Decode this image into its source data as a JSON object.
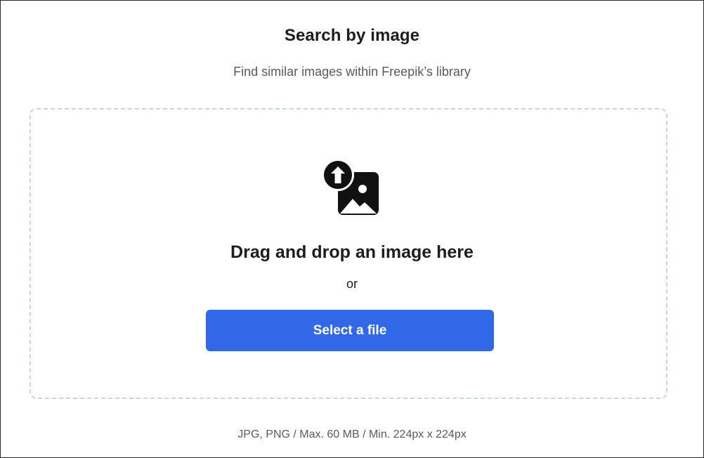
{
  "header": {
    "title": "Search by image",
    "subtitle": "Find similar images within Freepik’s library"
  },
  "dropzone": {
    "icon": "image-upload-icon",
    "heading": "Drag and drop an image here",
    "separator": "or",
    "button_label": "Select a file"
  },
  "footer": {
    "requirements": "JPG, PNG / Max. 60 MB / Min. 224px x 224px"
  },
  "colors": {
    "accent": "#3168e8",
    "dropzone_border": "#c4d6ea",
    "icon": "#111111"
  }
}
